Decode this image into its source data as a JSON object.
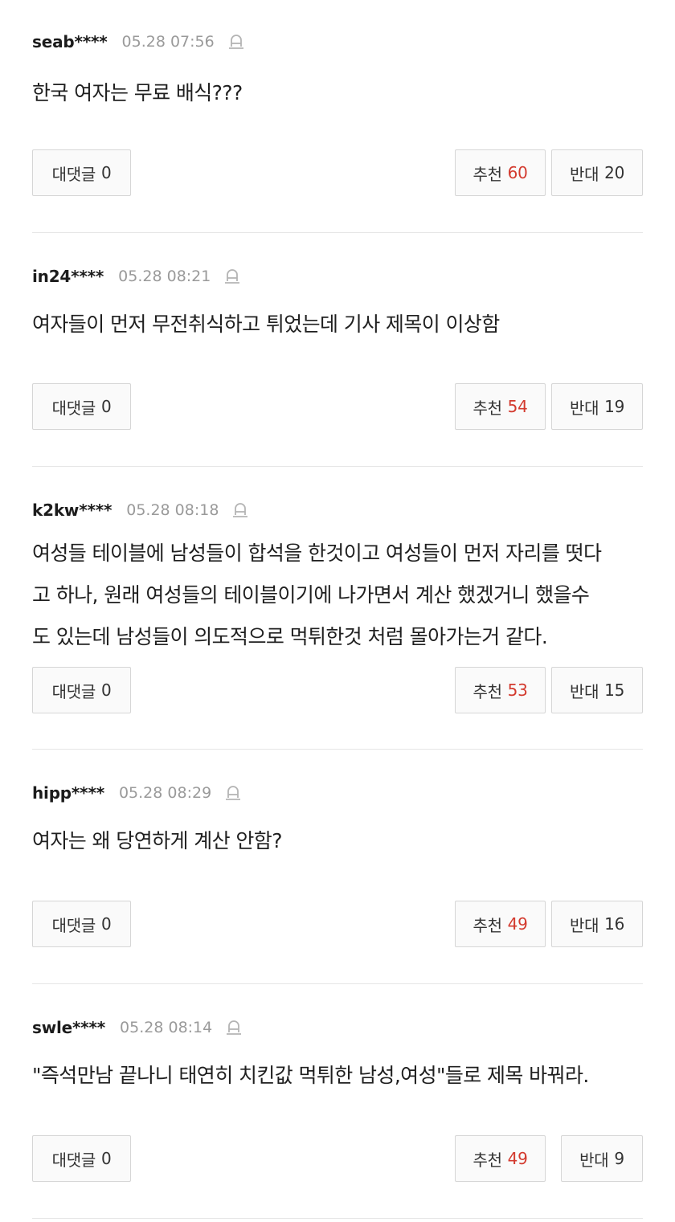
{
  "comments": [
    {
      "user": "seab****",
      "time": "05.28 07:56",
      "text": "한국 여자는 무료 배식???",
      "reply_label": "대댓글",
      "reply_count": "0",
      "up_label": "추천",
      "up_count": "60",
      "down_label": "반대",
      "down_count": "20"
    },
    {
      "user": "in24****",
      "time": "05.28 08:21",
      "text": "여자들이 먼저 무전취식하고 튀었는데 기사 제목이 이상함",
      "reply_label": "대댓글",
      "reply_count": "0",
      "up_label": "추천",
      "up_count": "54",
      "down_label": "반대",
      "down_count": "19"
    },
    {
      "user": "k2kw****",
      "time": "05.28 08:18",
      "text": "여성들 테이블에 남성들이 합석을 한것이고 여성들이 먼저 자리를 떳다\n고 하나, 원래 여성들의 테이블이기에 나가면서 계산 했겠거니 했을수\n도 있는데 남성들이 의도적으로 먹튀한것 처럼 몰아가는거 같다.",
      "reply_label": "대댓글",
      "reply_count": "0",
      "up_label": "추천",
      "up_count": "53",
      "down_label": "반대",
      "down_count": "15"
    },
    {
      "user": "hipp****",
      "time": "05.28 08:29",
      "text": "여자는 왜 당연하게 계산 안함?",
      "reply_label": "대댓글",
      "reply_count": "0",
      "up_label": "추천",
      "up_count": "49",
      "down_label": "반대",
      "down_count": "16"
    },
    {
      "user": "swle****",
      "time": "05.28 08:14",
      "text": "\"즉석만남 끝나니 태연히 치킨값 먹튀한 남성,여성\"들로 제목 바꿔라.",
      "reply_label": "대댓글",
      "reply_count": "0",
      "up_label": "추천",
      "up_count": "49",
      "down_label": "반대",
      "down_count": "9"
    }
  ],
  "icons": {
    "report": "report-siren-icon"
  },
  "colors": {
    "up_count": "#d33a2e",
    "meta_time": "#9a9a9a",
    "divider": "#e6e6e6"
  }
}
